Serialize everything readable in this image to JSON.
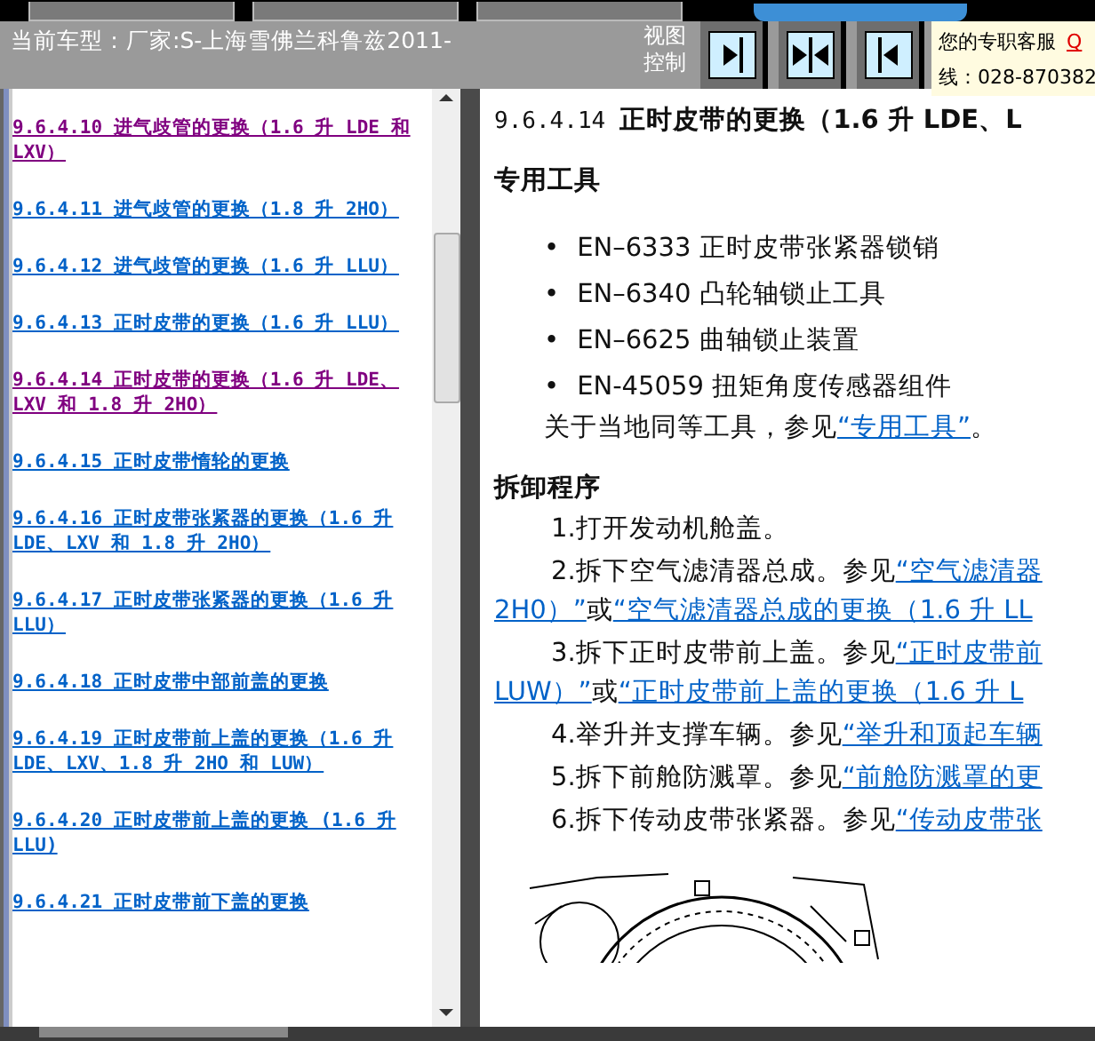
{
  "header": {
    "car_model": "当前车型：厂家:S-上海雪佛兰科鲁兹2011-",
    "view_control": "视图控制",
    "view_buttons": [
      {
        "kind": "right"
      },
      {
        "kind": "split"
      },
      {
        "kind": "left"
      }
    ],
    "service": {
      "label": "您的专职客服",
      "qq": "Q",
      "phone": "线：028-870382"
    }
  },
  "toc": [
    {
      "text": "9.6.4.10 进气歧管的更换（1.6 升 LDE 和 LXV）",
      "visited": true
    },
    {
      "text": "9.6.4.11 进气歧管的更换（1.8 升 2HO）",
      "visited": false
    },
    {
      "text": "9.6.4.12 进气歧管的更换（1.6 升 LLU）",
      "visited": false
    },
    {
      "text": "9.6.4.13 正时皮带的更换（1.6 升 LLU）",
      "visited": false
    },
    {
      "text": "9.6.4.14 正时皮带的更换（1.6 升 LDE、LXV 和 1.8 升 2HO）",
      "visited": true
    },
    {
      "text": "9.6.4.15 正时皮带惰轮的更换",
      "visited": false
    },
    {
      "text": "9.6.4.16 正时皮带张紧器的更换（1.6 升 LDE、LXV 和 1.8 升 2HO）",
      "visited": false
    },
    {
      "text": "9.6.4.17 正时皮带张紧器的更换（1.6 升 LLU）",
      "visited": false
    },
    {
      "text": "9.6.4.18 正时皮带中部前盖的更换",
      "visited": false
    },
    {
      "text": "9.6.4.19 正时皮带前上盖的更换（1.6 升 LDE、LXV、1.8 升 2HO 和 LUW）",
      "visited": false
    },
    {
      "text": "9.6.4.20 正时皮带前上盖的更换 (1.6 升 LLU)",
      "visited": false
    },
    {
      "text": "9.6.4.21 正时皮带前下盖的更换",
      "visited": false
    }
  ],
  "article": {
    "number": "9.6.4.14",
    "title": "正时皮带的更换（1.6 升 LDE、L",
    "tools_heading": "专用工具",
    "tools": [
      {
        "bullet": "•",
        "text": "EN–6333 正时皮带张紧器锁销"
      },
      {
        "bullet": "•",
        "text": "EN–6340 凸轮轴锁止工具"
      },
      {
        "bullet": "•",
        "text": "EN–6625 曲轴锁止装置"
      },
      {
        "bullet": "•",
        "text": "EN-45059 扭矩角度传感器组件"
      }
    ],
    "tools_note": {
      "text": "关于当地同等工具，参见",
      "link": "“专用工具”",
      "after": "。"
    },
    "procedure_heading": "拆卸程序",
    "steps": [
      {
        "parts": [
          {
            "kind": "text",
            "text": "1.打开发动机舱盖。"
          }
        ]
      },
      {
        "parts": [
          {
            "kind": "text",
            "text": "2.拆下空气滤清器总成。参见"
          },
          {
            "kind": "link",
            "text": "“空气滤清器"
          }
        ]
      },
      {
        "parts": [
          {
            "kind": "link",
            "text": "2H0）”"
          },
          {
            "kind": "text",
            "text": "或"
          },
          {
            "kind": "link",
            "text": "“空气滤清器总成的更换（1.6 升 LL"
          }
        ],
        "kind": "continuation"
      },
      {
        "parts": [
          {
            "kind": "text",
            "text": "3.拆下正时皮带前上盖。参见"
          },
          {
            "kind": "link",
            "text": "“正时皮带前"
          }
        ]
      },
      {
        "parts": [
          {
            "kind": "link",
            "text": "LUW）”"
          },
          {
            "kind": "text",
            "text": "或"
          },
          {
            "kind": "link",
            "text": "“正时皮带前上盖的更换（1.6 升 L"
          }
        ],
        "kind": "continuation"
      },
      {
        "parts": [
          {
            "kind": "text",
            "text": "4.举升并支撑车辆。参见"
          },
          {
            "kind": "link",
            "text": "“举升和顶起车辆"
          }
        ]
      },
      {
        "parts": [
          {
            "kind": "text",
            "text": "5.拆下前舱防溅罩。参见"
          },
          {
            "kind": "link",
            "text": "“前舱防溅罩的更"
          }
        ]
      },
      {
        "parts": [
          {
            "kind": "text",
            "text": "6.拆下传动皮带张紧器。参见"
          },
          {
            "kind": "link",
            "text": "“传动皮带张"
          }
        ]
      }
    ]
  }
}
